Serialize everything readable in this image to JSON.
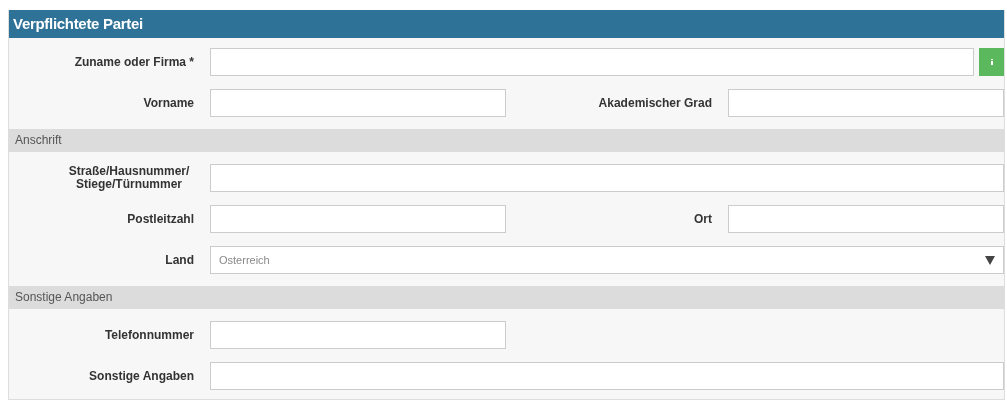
{
  "panel": {
    "title": "Verpflichtete Partei"
  },
  "groups": [
    {
      "rows": [
        {
          "fields": [
            {
              "kind": "text_with_button",
              "label": "Zuname oder Firma *"
            }
          ]
        },
        {
          "fields": [
            {
              "kind": "text",
              "label": "Vorname"
            },
            {
              "kind": "text",
              "label": "Akademischer Grad"
            }
          ]
        }
      ]
    },
    {
      "heading": "Anschrift",
      "rows": [
        {
          "fields": [
            {
              "kind": "text",
              "label": "Straße/Hausnummer/ Stiege/Türnummer"
            }
          ]
        },
        {
          "fields": [
            {
              "kind": "text",
              "label": "Postleitzahl"
            },
            {
              "kind": "text",
              "label": "Ort"
            }
          ]
        },
        {
          "fields": [
            {
              "kind": "select",
              "label": "Land",
              "value": "Osterreich"
            }
          ]
        }
      ]
    },
    {
      "heading": "Sonstige Angaben",
      "rows": [
        {
          "fields": [
            {
              "kind": "short_text",
              "label": "Telefonnummer"
            }
          ]
        },
        {
          "fields": [
            {
              "kind": "text",
              "label": "Sonstige Angaben"
            }
          ]
        }
      ]
    }
  ]
}
